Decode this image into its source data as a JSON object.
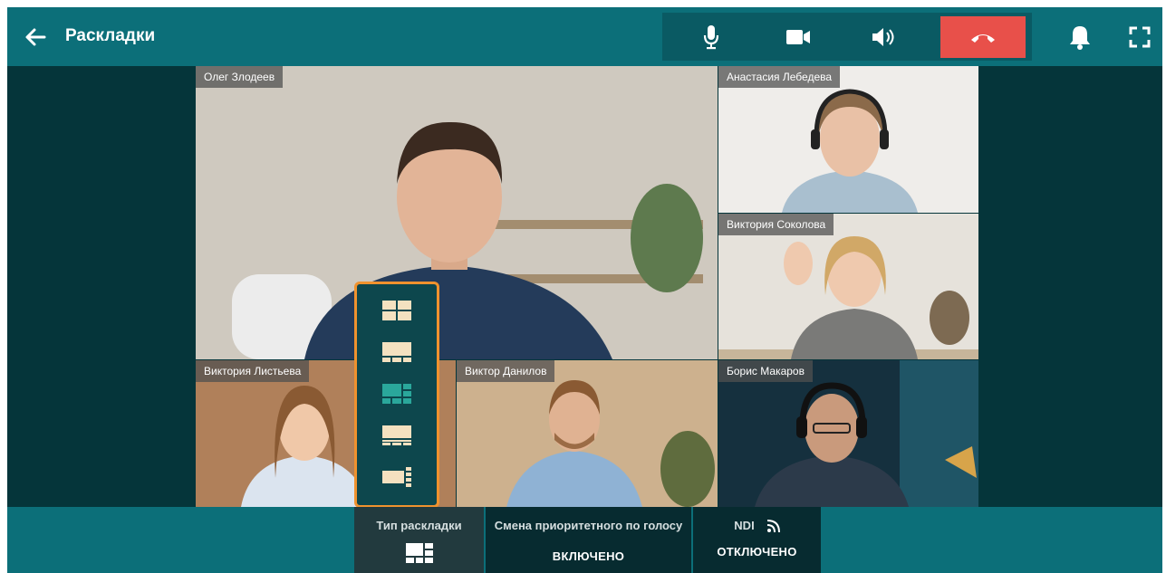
{
  "header": {
    "title": "Раскладки",
    "back_icon": "arrow-left-icon",
    "controls": {
      "mic_icon": "microphone-icon",
      "camera_icon": "video-camera-icon",
      "speaker_icon": "speaker-icon",
      "hangup_icon": "phone-hangup-icon",
      "hangup_color": "#e8504a"
    },
    "bell_icon": "bell-icon",
    "fullscreen_icon": "fullscreen-icon"
  },
  "participants": [
    {
      "name": "Олег Злодеев"
    },
    {
      "name": "Анастасия Лебедева"
    },
    {
      "name": "Виктория Соколова"
    },
    {
      "name": "Виктория Листьева"
    },
    {
      "name": "Виктор Данилов"
    },
    {
      "name": "Борис Макаров"
    }
  ],
  "layout_popup": {
    "options": [
      "grid-2x2",
      "speaker-top",
      "main-with-sidebar",
      "speaker-bottom",
      "main-right-list"
    ],
    "selected": "main-with-sidebar",
    "accent_color": "#f0922e",
    "selected_color": "#2aa79b"
  },
  "bottom_bar": {
    "layout_type": {
      "title": "Тип раскладки",
      "icon": "layout-grid-icon"
    },
    "voice_priority": {
      "title": "Смена приоритетного по голосу",
      "value": "ВКЛЮЧЕНО"
    },
    "ndi": {
      "title": "NDI",
      "icon": "rss-icon",
      "value": "ОТКЛЮЧЕНО"
    }
  },
  "colors": {
    "header_bg": "#0c6f79",
    "app_bg": "#05353a",
    "panel_bg": "#072b30"
  }
}
